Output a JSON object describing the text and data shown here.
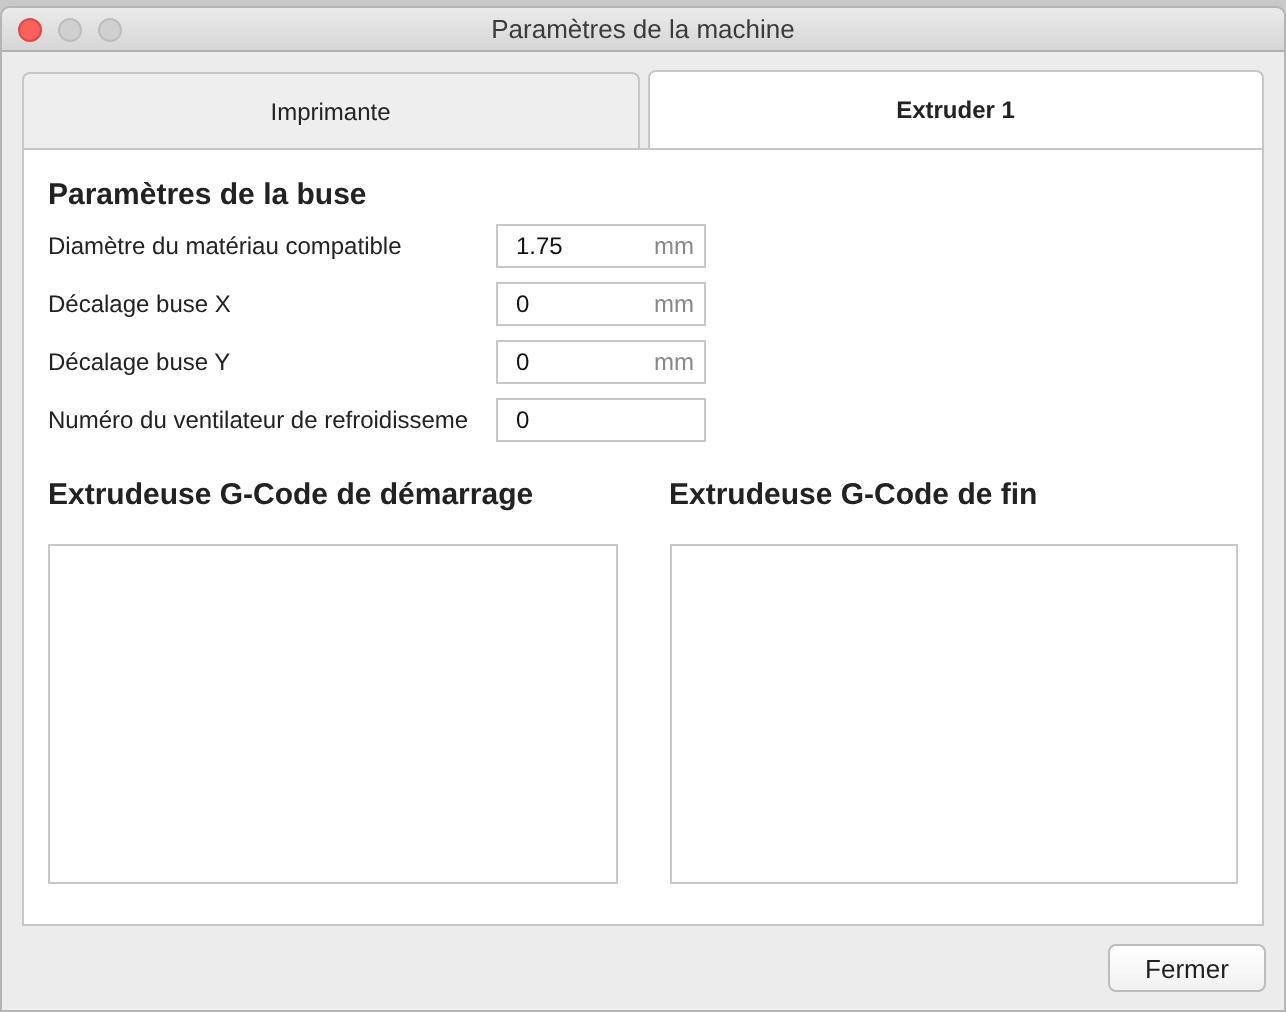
{
  "window": {
    "title": "Paramètres de la machine"
  },
  "tabs": [
    {
      "label": "Imprimante",
      "selected": false
    },
    {
      "label": "Extruder 1",
      "selected": true
    }
  ],
  "nozzle_settings": {
    "heading": "Paramètres de la buse",
    "fields": [
      {
        "label": "Diamètre du matériau compatible",
        "value": "1.75",
        "unit": "mm"
      },
      {
        "label": "Décalage buse X",
        "value": "0",
        "unit": "mm"
      },
      {
        "label": "Décalage buse Y",
        "value": "0",
        "unit": "mm"
      },
      {
        "label": "Numéro du ventilateur de refroidisseme",
        "value": "0"
      }
    ]
  },
  "gcode": [
    {
      "heading": "Extrudeuse G-Code de démarrage"
    },
    {
      "heading": "Extrudeuse G-Code de fin"
    }
  ],
  "buttons": [
    "Fermer"
  ]
}
